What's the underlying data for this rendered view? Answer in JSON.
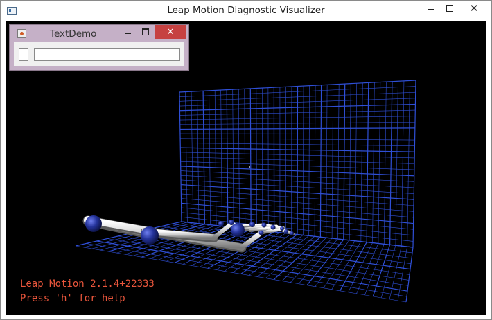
{
  "main_window": {
    "title": "Leap Motion Diagnostic Visualizer",
    "icon": "window-app-icon",
    "controls": [
      "minimize-icon",
      "maximize-icon",
      "close-icon"
    ]
  },
  "viewport": {
    "background_color": "#000000",
    "grid_color": "#2f4fd6",
    "overlay_color": "#e8553b",
    "version_text": "Leap Motion 2.1.4+22333",
    "help_text": "Press 'h' for help"
  },
  "textdemo_window": {
    "title": "TextDemo",
    "icon": "java-icon",
    "text_field_value": "",
    "small_field_value": "",
    "title_bar_color": "#c5b0c7",
    "close_color": "#c64141"
  }
}
